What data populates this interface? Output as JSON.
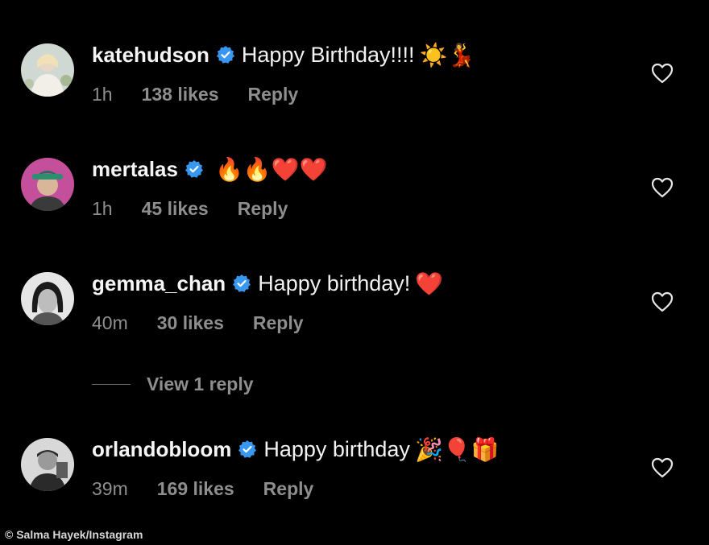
{
  "comments": [
    {
      "username": "katehudson",
      "text": "Happy Birthday!!!!",
      "emojis": "☀️💃",
      "time": "1h",
      "likes": "138 likes",
      "reply": "Reply",
      "avatar_colors": {
        "bg": "#cfd8d2",
        "fg": "#e9e4dc",
        "accent": "#b9c4a8"
      }
    },
    {
      "username": "mertalas",
      "text": "",
      "emojis": "🔥🔥❤️❤️",
      "time": "1h",
      "likes": "45 likes",
      "reply": "Reply",
      "avatar_colors": {
        "bg": "#c44f9a",
        "fg": "#2d6b5f",
        "accent": "#d9b59a"
      }
    },
    {
      "username": "gemma_chan",
      "text": "Happy birthday!",
      "emojis": "❤️",
      "time": "40m",
      "likes": "30 likes",
      "reply": "Reply",
      "avatar_colors": {
        "bg": "#e6e6e6",
        "fg": "#1a1a1a",
        "accent": "#888888"
      }
    },
    {
      "username": "orlandobloom",
      "text": "Happy birthday",
      "emojis": "🎉🎈🎁",
      "time": "39m",
      "likes": "169 likes",
      "reply": "Reply",
      "avatar_colors": {
        "bg": "#d8d8d8",
        "fg": "#2a2a2a",
        "accent": "#5c5c5c"
      }
    }
  ],
  "view_replies": "View 1 reply",
  "credit": "© Salma Hayek/Instagram",
  "colors": {
    "verified": "#3897f0",
    "meta": "#8e8e8e",
    "background": "#000000"
  }
}
